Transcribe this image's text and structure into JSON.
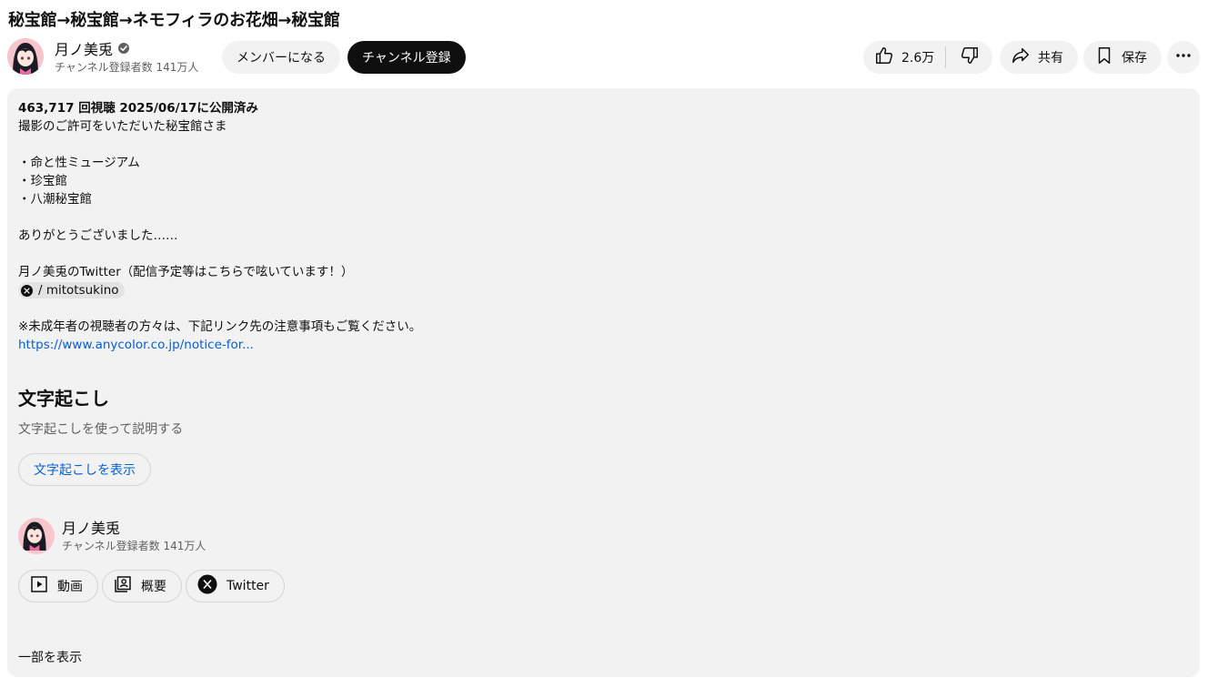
{
  "video": {
    "title": "秘宝館→秘宝館→ネモフィラのお花畑→秘宝館"
  },
  "owner": {
    "name": "月ノ美兎",
    "verified_icon": "verified-check-icon",
    "subscribers": "チャンネル登録者数 141万人",
    "member_label": "メンバーになる",
    "subscribe_label": "チャンネル登録"
  },
  "actions": {
    "like_icon": "thumbs-up-icon",
    "like_count": "2.6万",
    "dislike_icon": "thumbs-down-icon",
    "share_icon": "share-arrow-icon",
    "share_label": "共有",
    "save_icon": "bookmark-icon",
    "save_label": "保存",
    "more_icon": "more-horizontal-icon"
  },
  "description": {
    "meta": "463,717 回視聴  2025/06/17に公開済み",
    "intro": "撮影のご許可をいただいた秘宝館さま",
    "list": [
      "・命と性ミュージアム",
      "・珍宝館",
      "・八潮秘宝館"
    ],
    "thanks": "ありがとうございました……",
    "twitter_note": "月ノ美兎のTwitter（配信予定等はこちらで呟いています！）",
    "twitter_chip": "/ mitotsukino",
    "notice": "※未成年者の視聴者の方々は、下記リンク先の注意事項もご覧ください。",
    "notice_link": "https://www.anycolor.co.jp/notice-for..."
  },
  "transcript": {
    "title": "文字起こし",
    "desc": "文字起こしを使って説明する",
    "button": "文字起こしを表示"
  },
  "channel": {
    "name": "月ノ美兎",
    "subscribers": "チャンネル登録者数 141万人",
    "videos_label": "動画",
    "about_label": "概要",
    "twitter_label": "Twitter"
  },
  "show_less": "一部を表示",
  "colors": {
    "accent_link": "#065fd4",
    "surface": "#f2f2f2",
    "text": "#0f0f0f",
    "secondary_text": "#606060"
  }
}
